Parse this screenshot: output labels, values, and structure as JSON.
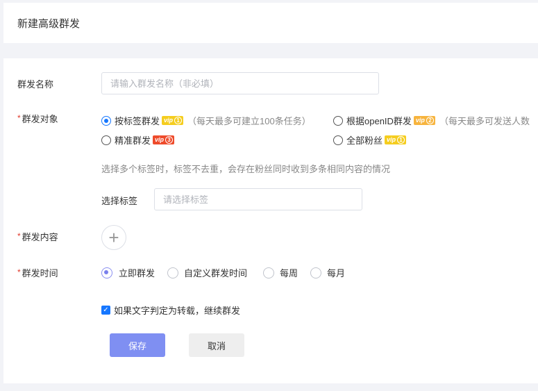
{
  "page": {
    "title": "新建高级群发"
  },
  "form": {
    "name": {
      "label": "群发名称",
      "placeholder": "请输入群发名称（非必填）"
    },
    "target": {
      "required_mark": "*",
      "label": "群发对象",
      "options": [
        {
          "label": "按标签群发",
          "vip_text": "vip",
          "vip_level": "1",
          "vip_color": "#f5cd1f",
          "hint": "（每天最多可建立100条任务）",
          "checked": true
        },
        {
          "label": "根据openID群发",
          "vip_text": "vip",
          "vip_level": "2",
          "vip_color": "#f7b43e",
          "hint": "（每天最多可发送人数",
          "checked": false
        },
        {
          "label": "精准群发",
          "vip_text": "vip",
          "vip_level": "3",
          "vip_color": "#ee4b2b",
          "checked": false
        },
        {
          "label": "全部粉丝",
          "vip_text": "vip",
          "vip_level": "1",
          "vip_color": "#f5cd1f",
          "checked": false
        }
      ],
      "tip": "选择多个标签时，标签不去重，会存在粉丝同时收到多条相同内容的情况",
      "tag_label": "选择标签",
      "tag_placeholder": "请选择标签"
    },
    "content": {
      "required_mark": "*",
      "label": "群发内容",
      "add_symbol": "+"
    },
    "time": {
      "required_mark": "*",
      "label": "群发时间",
      "options": [
        {
          "label": "立即群发",
          "checked": true
        },
        {
          "label": "自定义群发时间",
          "checked": false
        },
        {
          "label": "每周",
          "checked": false
        },
        {
          "label": "每月",
          "checked": false
        }
      ]
    },
    "repost": {
      "label": "如果文字判定为转载，继续群发",
      "checked": true
    },
    "buttons": {
      "save": "保存",
      "cancel": "取消"
    }
  },
  "colors": {
    "primary": "#7f8ff2",
    "radio_blue": "#1677ff",
    "required": "#e0392b"
  }
}
